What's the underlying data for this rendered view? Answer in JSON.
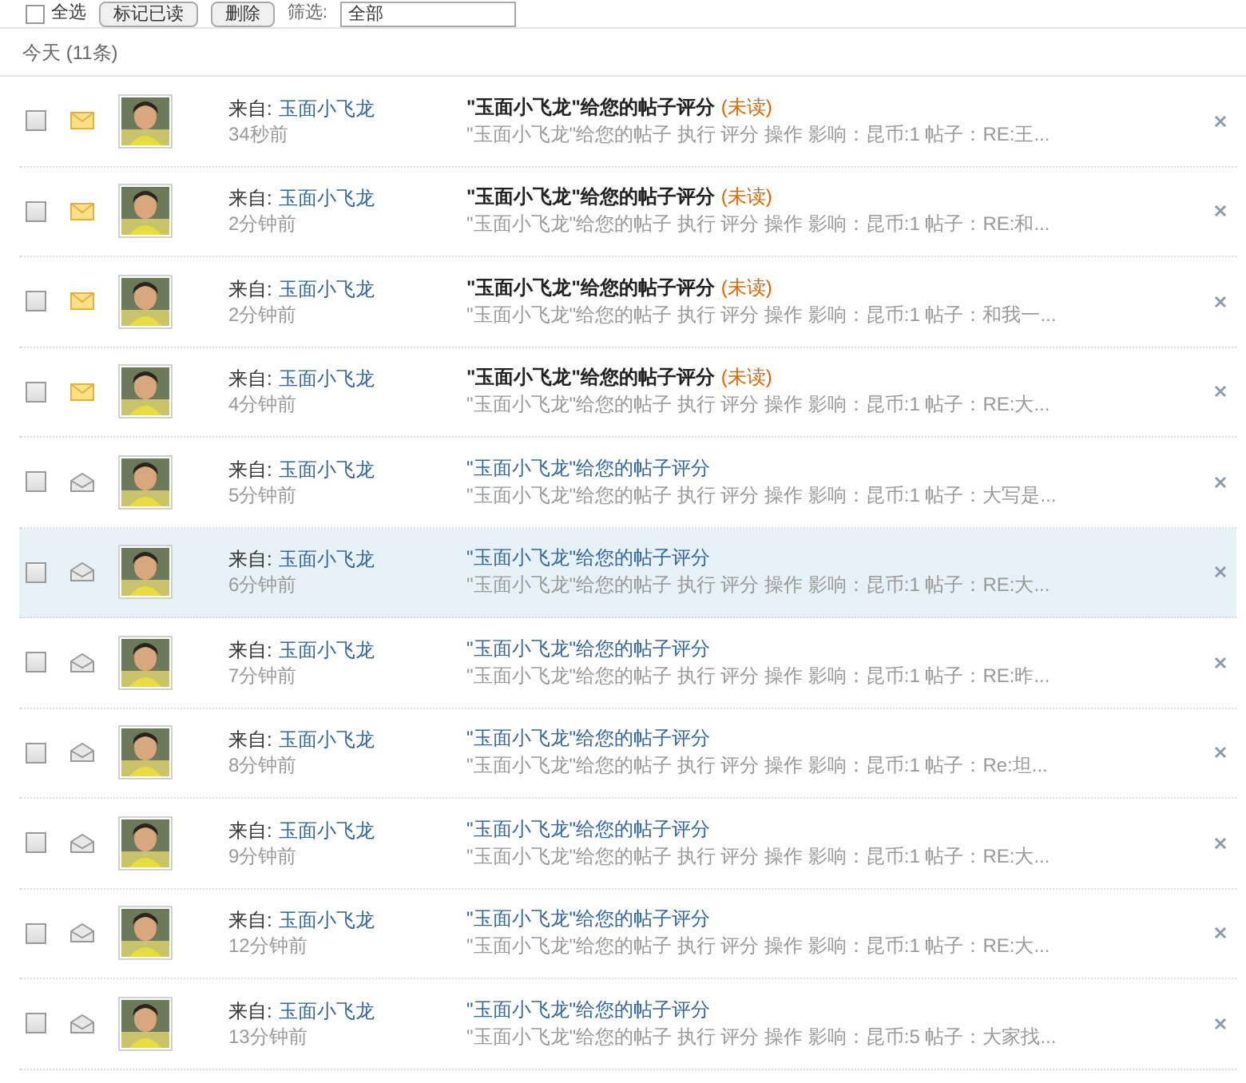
{
  "toolbar": {
    "select_all": {
      "label": "全选",
      "checked": false
    },
    "buttons": [
      "标记已读",
      "删除"
    ],
    "filter": {
      "label": "筛选:",
      "value": "全部"
    }
  },
  "group": {
    "title": "今天 (11条)"
  },
  "notices": [
    {
      "selected": false,
      "checked": false,
      "unread": true,
      "from_label": "来自:",
      "from": "玉面小飞龙",
      "time": "34秒前",
      "title": "\"玉面小飞龙\"给您的帖子评分",
      "unread_tag": "(未读)",
      "summary": "\"玉面小飞龙\"给您的帖子 执行 评分 操作 影响：昆币:1 帖子：RE:王..."
    },
    {
      "selected": false,
      "checked": false,
      "unread": true,
      "from_label": "来自:",
      "from": "玉面小飞龙",
      "time": "2分钟前",
      "title": "\"玉面小飞龙\"给您的帖子评分",
      "unread_tag": "(未读)",
      "summary": "\"玉面小飞龙\"给您的帖子 执行 评分 操作 影响：昆币:1 帖子：RE:和..."
    },
    {
      "selected": false,
      "checked": false,
      "unread": true,
      "from_label": "来自:",
      "from": "玉面小飞龙",
      "time": "2分钟前",
      "title": "\"玉面小飞龙\"给您的帖子评分",
      "unread_tag": "(未读)",
      "summary": "\"玉面小飞龙\"给您的帖子 执行 评分 操作 影响：昆币:1 帖子：和我一..."
    },
    {
      "selected": false,
      "checked": false,
      "unread": true,
      "from_label": "来自:",
      "from": "玉面小飞龙",
      "time": "4分钟前",
      "title": "\"玉面小飞龙\"给您的帖子评分",
      "unread_tag": "(未读)",
      "summary": "\"玉面小飞龙\"给您的帖子 执行 评分 操作 影响：昆币:1 帖子：RE:大..."
    },
    {
      "selected": false,
      "checked": false,
      "unread": false,
      "from_label": "来自:",
      "from": "玉面小飞龙",
      "time": "5分钟前",
      "title": "\"玉面小飞龙\"给您的帖子评分",
      "summary": "\"玉面小飞龙\"给您的帖子 执行 评分 操作 影响：昆币:1 帖子：大写是..."
    },
    {
      "selected": true,
      "checked": false,
      "unread": false,
      "from_label": "来自:",
      "from": "玉面小飞龙",
      "time": "6分钟前",
      "title": "\"玉面小飞龙\"给您的帖子评分",
      "summary": "\"玉面小飞龙\"给您的帖子 执行 评分 操作 影响：昆币:1 帖子：RE:大..."
    },
    {
      "selected": false,
      "checked": false,
      "unread": false,
      "from_label": "来自:",
      "from": "玉面小飞龙",
      "time": "7分钟前",
      "title": "\"玉面小飞龙\"给您的帖子评分",
      "summary": "\"玉面小飞龙\"给您的帖子 执行 评分 操作 影响：昆币:1 帖子：RE:昨..."
    },
    {
      "selected": false,
      "checked": false,
      "unread": false,
      "from_label": "来自:",
      "from": "玉面小飞龙",
      "time": "8分钟前",
      "title": "\"玉面小飞龙\"给您的帖子评分",
      "summary": "\"玉面小飞龙\"给您的帖子 执行 评分 操作 影响：昆币:1 帖子：Re:坦..."
    },
    {
      "selected": false,
      "checked": false,
      "unread": false,
      "from_label": "来自:",
      "from": "玉面小飞龙",
      "time": "9分钟前",
      "title": "\"玉面小飞龙\"给您的帖子评分",
      "summary": "\"玉面小飞龙\"给您的帖子 执行 评分 操作 影响：昆币:1 帖子：RE:大..."
    },
    {
      "selected": false,
      "checked": false,
      "unread": false,
      "from_label": "来自:",
      "from": "玉面小飞龙",
      "time": "12分钟前",
      "title": "\"玉面小飞龙\"给您的帖子评分",
      "summary": "\"玉面小飞龙\"给您的帖子 执行 评分 操作 影响：昆币:1 帖子：RE:大..."
    },
    {
      "selected": false,
      "checked": false,
      "unread": false,
      "from_label": "来自:",
      "from": "玉面小飞龙",
      "time": "13分钟前",
      "title": "\"玉面小飞龙\"给您的帖子评分",
      "summary": "\"玉面小飞龙\"给您的帖子 执行 评分 操作 影响：昆币:5 帖子：大家找..."
    }
  ]
}
